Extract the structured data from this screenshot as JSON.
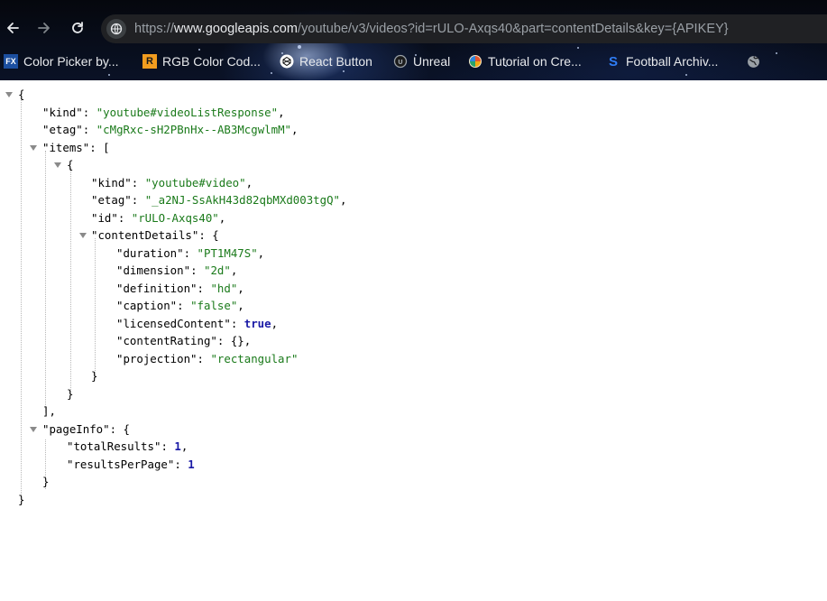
{
  "browser": {
    "url_scheme": "https://",
    "url_host": "www.googleapis.com",
    "url_rest": "/youtube/v3/videos?id=rULO-Axqs40&part=contentDetails&key={APIKEY}",
    "bookmarks": [
      {
        "label": "Color Picker by...",
        "icon": "fx-icon"
      },
      {
        "label": "RGB Color Cod...",
        "icon": "r-icon"
      },
      {
        "label": "React Button",
        "icon": "codepen-icon"
      },
      {
        "label": "Unreal",
        "icon": "unreal-icon"
      },
      {
        "label": "Tutorial on Cre...",
        "icon": "pinwheel-icon"
      },
      {
        "label": "Football Archiv...",
        "icon": "s-icon"
      }
    ]
  },
  "json_view": {
    "root_open": "{",
    "kind_key": "\"kind\"",
    "kind_val": "\"youtube#videoListResponse\"",
    "etag_key": "\"etag\"",
    "etag_val": "\"cMgRxc-sH2PBnHx--AB3McgwlmM\"",
    "items_key": "\"items\"",
    "items_open": "[",
    "item_open": "{",
    "item_kind_key": "\"kind\"",
    "item_kind_val": "\"youtube#video\"",
    "item_etag_key": "\"etag\"",
    "item_etag_val": "\"_a2NJ-SsAkH43d82qbMXd003tgQ\"",
    "item_id_key": "\"id\"",
    "item_id_val": "\"rULO-Axqs40\"",
    "cd_key": "\"contentDetails\"",
    "cd_open": "{",
    "duration_key": "\"duration\"",
    "duration_val": "\"PT1M47S\"",
    "dimension_key": "\"dimension\"",
    "dimension_val": "\"2d\"",
    "definition_key": "\"definition\"",
    "definition_val": "\"hd\"",
    "caption_key": "\"caption\"",
    "caption_val": "\"false\"",
    "licensed_key": "\"licensedContent\"",
    "licensed_val": "true",
    "rating_key": "\"contentRating\"",
    "rating_val": "{}",
    "projection_key": "\"projection\"",
    "projection_val": "\"rectangular\"",
    "cd_close": "}",
    "item_close": "}",
    "items_close": "],",
    "pageinfo_key": "\"pageInfo\"",
    "pageinfo_open": "{",
    "total_key": "\"totalResults\"",
    "total_val": "1",
    "perpage_key": "\"resultsPerPage\"",
    "perpage_val": "1",
    "pageinfo_close": "}",
    "root_close": "}"
  }
}
